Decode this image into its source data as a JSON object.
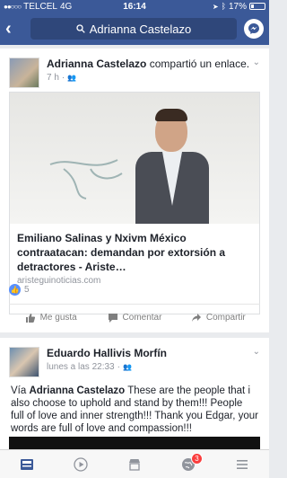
{
  "status_bar": {
    "carrier": "TELCEL",
    "network": "4G",
    "time": "16:14",
    "battery": "17%"
  },
  "navbar": {
    "back_icon": "back-chevron-icon",
    "search_value": "Adrianna Castelazo"
  },
  "post1": {
    "author": "Adrianna Castelazo",
    "action": "compartió un enlace.",
    "time": "7 h",
    "link_title": "Emiliano Salinas y Nxivm México contraatacan: demandan por extorsión a detractores - Ariste…",
    "link_domain": "aristeguinoticias.com",
    "reaction_count": "5",
    "actions": {
      "like": "Me gusta",
      "comment": "Comentar",
      "share": "Compartir"
    }
  },
  "post2": {
    "author": "Eduardo Hallivis Morfín",
    "time": "lunes a las 22:33",
    "text_prefix": "Vía ",
    "mention": "Adrianna Castelazo",
    "text": "   These are the people that i also choose to uphold and stand by them!!! People full of love  and inner strength!!! Thank you Edgar, your words are full of love and compassion!!!"
  },
  "tabbar": {
    "notifications_badge": "3"
  },
  "colors": {
    "brand": "#3b5998",
    "link_blue": "#5890ff",
    "badge_red": "#fa3e3e"
  }
}
